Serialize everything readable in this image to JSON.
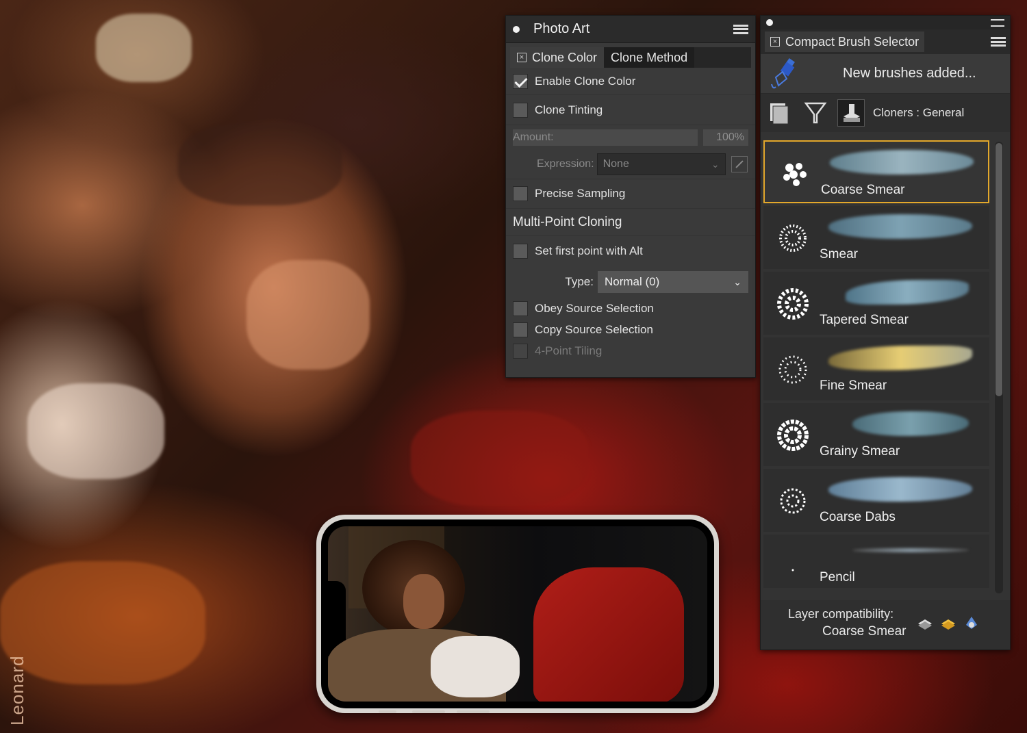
{
  "artist_signature": "Leonard",
  "photo_art": {
    "title": "Photo Art",
    "tabs": [
      {
        "label": "Clone Color",
        "active": false
      },
      {
        "label": "Clone Method",
        "active": true
      }
    ],
    "enable_clone_color": {
      "label": "Enable Clone Color",
      "checked": true
    },
    "clone_tinting": {
      "label": "Clone Tinting",
      "checked": false
    },
    "amount": {
      "label": "Amount:",
      "value": "100%"
    },
    "expression": {
      "label": "Expression:",
      "value": "None"
    },
    "precise_sampling": {
      "label": "Precise Sampling",
      "checked": false
    },
    "multi_point_title": "Multi-Point Cloning",
    "set_first_point": {
      "label": "Set first point with Alt",
      "checked": false
    },
    "type": {
      "label": "Type:",
      "value": "Normal (0)"
    },
    "obey_source": {
      "label": "Obey Source Selection",
      "checked": false
    },
    "copy_source": {
      "label": "Copy Source Selection",
      "checked": false
    },
    "four_point": {
      "label": "4-Point Tiling",
      "checked": false
    }
  },
  "brush_selector": {
    "tab_label": "Compact Brush Selector",
    "notice": "New brushes added...",
    "category": "Cloners : General",
    "brushes": [
      {
        "name": "Coarse Smear",
        "selected": true,
        "stroke_color": "#7a9aa8"
      },
      {
        "name": "Smear",
        "selected": false,
        "stroke_color": "#6f8fa0"
      },
      {
        "name": "Tapered Smear",
        "selected": false,
        "stroke_color": "#6f93a6"
      },
      {
        "name": "Fine Smear",
        "selected": false,
        "stroke_color": "#d3b25a"
      },
      {
        "name": "Grainy Smear",
        "selected": false,
        "stroke_color": "#6a8e9c"
      },
      {
        "name": "Coarse Dabs",
        "selected": false,
        "stroke_color": "#7f9fb8"
      },
      {
        "name": "Pencil",
        "selected": false,
        "stroke_color": "#8a9aa5"
      }
    ],
    "layer_compat_label": "Layer compatibility:",
    "layer_compat_brush": "Coarse Smear",
    "accent_color": "#e3a82b"
  }
}
